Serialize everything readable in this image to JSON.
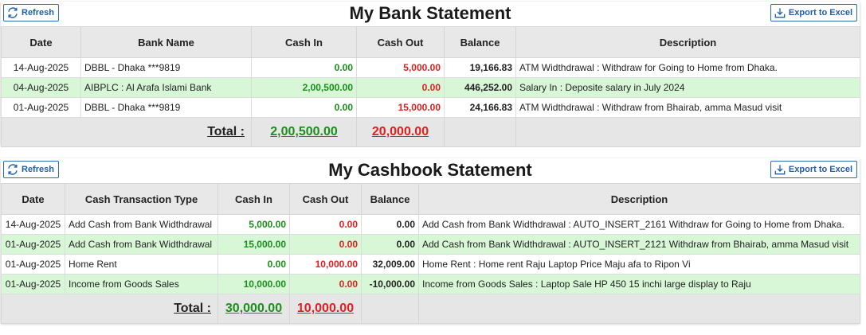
{
  "bank": {
    "title": "My Bank Statement",
    "refresh_label": "Refresh",
    "export_label": "Export to Excel",
    "columns": [
      "Date",
      "Bank Name",
      "Cash In",
      "Cash Out",
      "Balance",
      "Description"
    ],
    "rows": [
      {
        "date": "14-Aug-2025",
        "bank": "DBBL - Dhaka ***9819",
        "cash_in": "0.00",
        "cash_out": "5,000.00",
        "balance": "19,166.83",
        "desc": "ATM Widthdrawal : Withdraw for Going to Home from Dhaka."
      },
      {
        "date": "04-Aug-2025",
        "bank": "AIBPLC : Al Arafa Islami Bank",
        "cash_in": "2,00,500.00",
        "cash_out": "0.00",
        "balance": "446,252.00",
        "desc": "Salary In : Deposite salary in July 2024"
      },
      {
        "date": "01-Aug-2025",
        "bank": "DBBL - Dhaka ***9819",
        "cash_in": "0.00",
        "cash_out": "15,000.00",
        "balance": "24,166.83",
        "desc": "ATM Widthdrawal : Withdraw from Bhairab, amma Masud visit"
      }
    ],
    "total_label": "Total :",
    "total_in": "2,00,500.00",
    "total_out": "20,000.00"
  },
  "cashbook": {
    "title": "My Cashbook Statement",
    "refresh_label": "Refresh",
    "export_label": "Export to Excel",
    "columns": [
      "Date",
      "Cash Transaction Type",
      "Cash In",
      "Cash Out",
      "Balance",
      "Description"
    ],
    "rows": [
      {
        "date": "14-Aug-2025",
        "type": "Add Cash from Bank Widthdrawal",
        "cash_in": "5,000.00",
        "cash_out": "0.00",
        "balance": "0.00",
        "desc": "Add Cash from Bank Widthdrawal : AUTO_INSERT_2161 Withdraw for Going to Home from Dhaka."
      },
      {
        "date": "01-Aug-2025",
        "type": "Add Cash from Bank Widthdrawal",
        "cash_in": "15,000.00",
        "cash_out": "0.00",
        "balance": "0.00",
        "desc": "Add Cash from Bank Widthdrawal : AUTO_INSERT_2121 Withdraw from Bhairab, amma Masud visit"
      },
      {
        "date": "01-Aug-2025",
        "type": "Home Rent",
        "cash_in": "0.00",
        "cash_out": "10,000.00",
        "balance": "32,009.00",
        "desc": "Home Rent : Home rent Raju Laptop Price Maju afa to Ripon Vi"
      },
      {
        "date": "01-Aug-2025",
        "type": "Income from Goods Sales",
        "cash_in": "10,000.00",
        "cash_out": "0.00",
        "balance": "-10,000.00",
        "desc": "Income from Goods Sales : Laptop Sale HP 450 15 inchi large display to Raju"
      }
    ],
    "total_label": "Total :",
    "total_in": "30,000.00",
    "total_out": "10,000.00"
  },
  "colors": {
    "accent": "#1f5fa8",
    "cash_in": "#1a8f1a",
    "cash_out": "#e02020",
    "alt_row": "#d7f7d7",
    "header_bg": "#e8e8e8"
  },
  "icons": {
    "refresh": "refresh-icon",
    "export": "download-icon"
  }
}
